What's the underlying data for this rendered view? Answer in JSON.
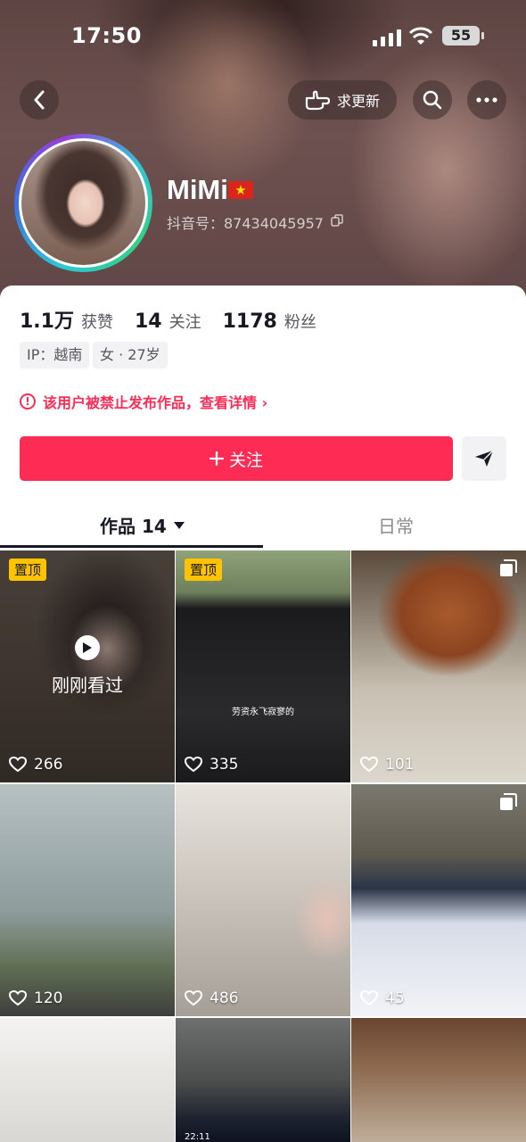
{
  "status_bar": {
    "time": "17:50",
    "battery": "55"
  },
  "header": {
    "refresh_label": "求更新",
    "name": "MiMi",
    "flag": "★",
    "douyin_id": "抖音号：87434045957"
  },
  "stats": [
    {
      "num": "1.1万",
      "label": "获赞"
    },
    {
      "num": "14",
      "label": "关注"
    },
    {
      "num": "1178",
      "label": "粉丝"
    }
  ],
  "tags": {
    "ip": "IP：越南",
    "gender": "女 · 27岁"
  },
  "warning": {
    "icon": "!",
    "text": "该用户被禁止发布作品，查看详情 ›"
  },
  "follow_label": "关注",
  "tabs": {
    "works": "作品 14",
    "daily": "日常"
  },
  "grid": {
    "pin_label": "置顶",
    "just_viewed": "刚刚看过",
    "items": [
      {
        "likes": "266"
      },
      {
        "likes": "335",
        "caption": "劳资永飞寂寥的"
      },
      {
        "likes": "101"
      },
      {
        "likes": "120"
      },
      {
        "likes": "486"
      },
      {
        "likes": "45"
      }
    ],
    "c8_time": "22:11"
  },
  "colors": {
    "accent": "#fe2c55",
    "pin": "#ffc300"
  }
}
